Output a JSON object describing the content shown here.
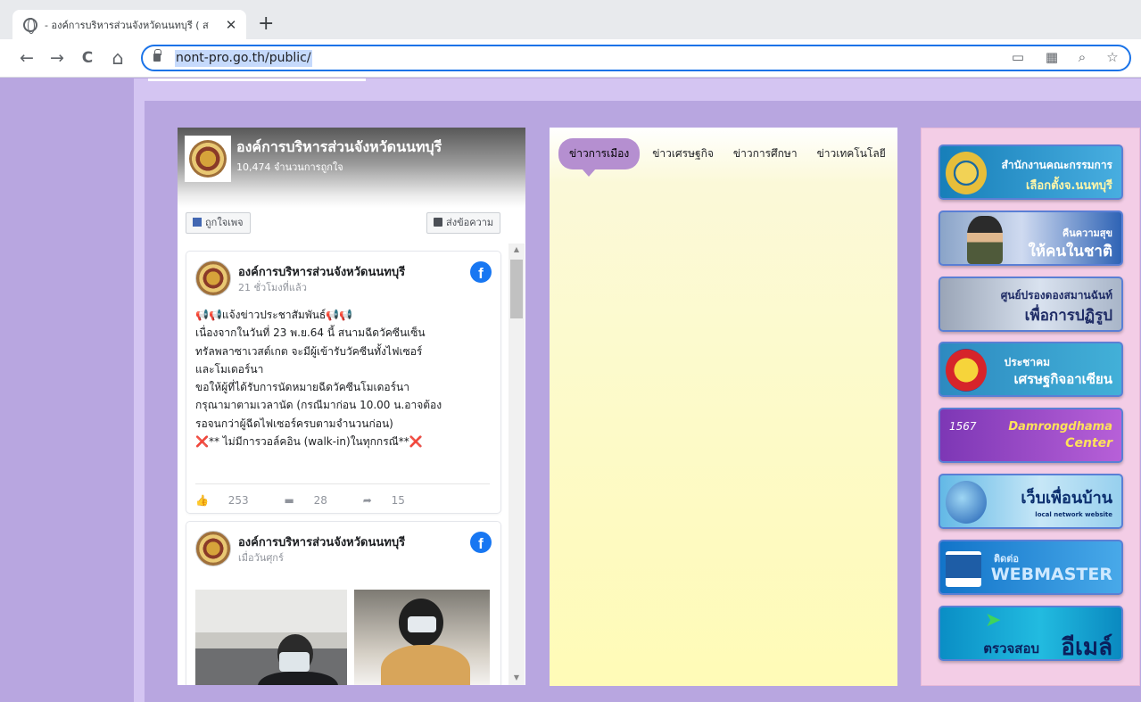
{
  "browser": {
    "tab_title": "- องค์การบริหารส่วนจังหวัดนนทบุรี ( ส",
    "tab_close": "✕",
    "new_tab": "+",
    "url": "nont-pro.go.th/public/",
    "nav": {
      "back": "←",
      "forward": "→",
      "reload": "C",
      "home": "⌂"
    }
  },
  "fb_page": {
    "name": "องค์การบริหารส่วนจังหวัดนนทบุรี",
    "likes": "10,474 จำนวนการถูกใจ",
    "like_button": "ถูกใจเพจ",
    "message_button": "ส่งข้อความ",
    "posts": [
      {
        "author": "องค์การบริหารส่วนจังหวัดนนทบุรี",
        "time": "21 ชั่วโมงที่แล้ว",
        "lines": [
          "📢📢แจ้งข่าวประชาสัมพันธ์📢📢",
          "เนื่องจากในวันที่ 23 พ.ย.64 นี้ สนามฉีดวัคซีนเซ็น",
          "ทรัลพลาซาเวสต์เกต จะมีผู้เข้ารับวัคซีนทั้งไฟเซอร์",
          "และโมเดอร์นา",
          "ขอให้ผู้ที่ได้รับการนัดหมายฉีดวัคซีนโมเดอร์นา",
          "กรุณามาตามเวลานัด (กรณีมาก่อน 10.00 น.อาจต้อง",
          "รอจนกว่าผู้ฉีดไฟเซอร์ครบตามจำนวนก่อน)",
          "❌** ไม่มีการวอล์คอิน (walk-in)ในทุกกรณี**❌"
        ],
        "likes": "253",
        "comments": "28",
        "shares": "15"
      },
      {
        "author": "องค์การบริหารส่วนจังหวัดนนทบุรี",
        "time": "เมื่อวันศุกร์"
      }
    ]
  },
  "news": {
    "tabs": [
      "ข่าวการเมือง",
      "ข่าวเศรษฐกิจ",
      "ข่าวการศึกษา",
      "ข่าวเทคโนโลยี"
    ],
    "active_tab": 0
  },
  "banners": [
    {
      "line1": "สำนักงานคณะกรรมการ",
      "line2": "เลือกตั้งจ.นนทบุรี"
    },
    {
      "line1": "คืนความสุข",
      "line2": "ให้คนในชาติ"
    },
    {
      "line1": "ศูนย์ปรองดองสมานฉันท์",
      "line2": "เพื่อการปฏิรูป"
    },
    {
      "line1": "ประชาคม",
      "line2": "เศรษฐกิจอาเซียน"
    },
    {
      "line1": "Damrongdhama",
      "line2": "Center",
      "badge": "1567"
    },
    {
      "line1": "เว็บเพื่อนบ้าน",
      "line2": "local network website"
    },
    {
      "line1": "ติดต่อ",
      "line2": "WEBMASTER"
    },
    {
      "line1": "ตรวจสอบ",
      "line2": "อีเมล์"
    }
  ],
  "colors": {
    "page_bg": "#b8a6e0",
    "news_active_tab": "#b58fd0",
    "banner_column": "#f3cde6"
  }
}
